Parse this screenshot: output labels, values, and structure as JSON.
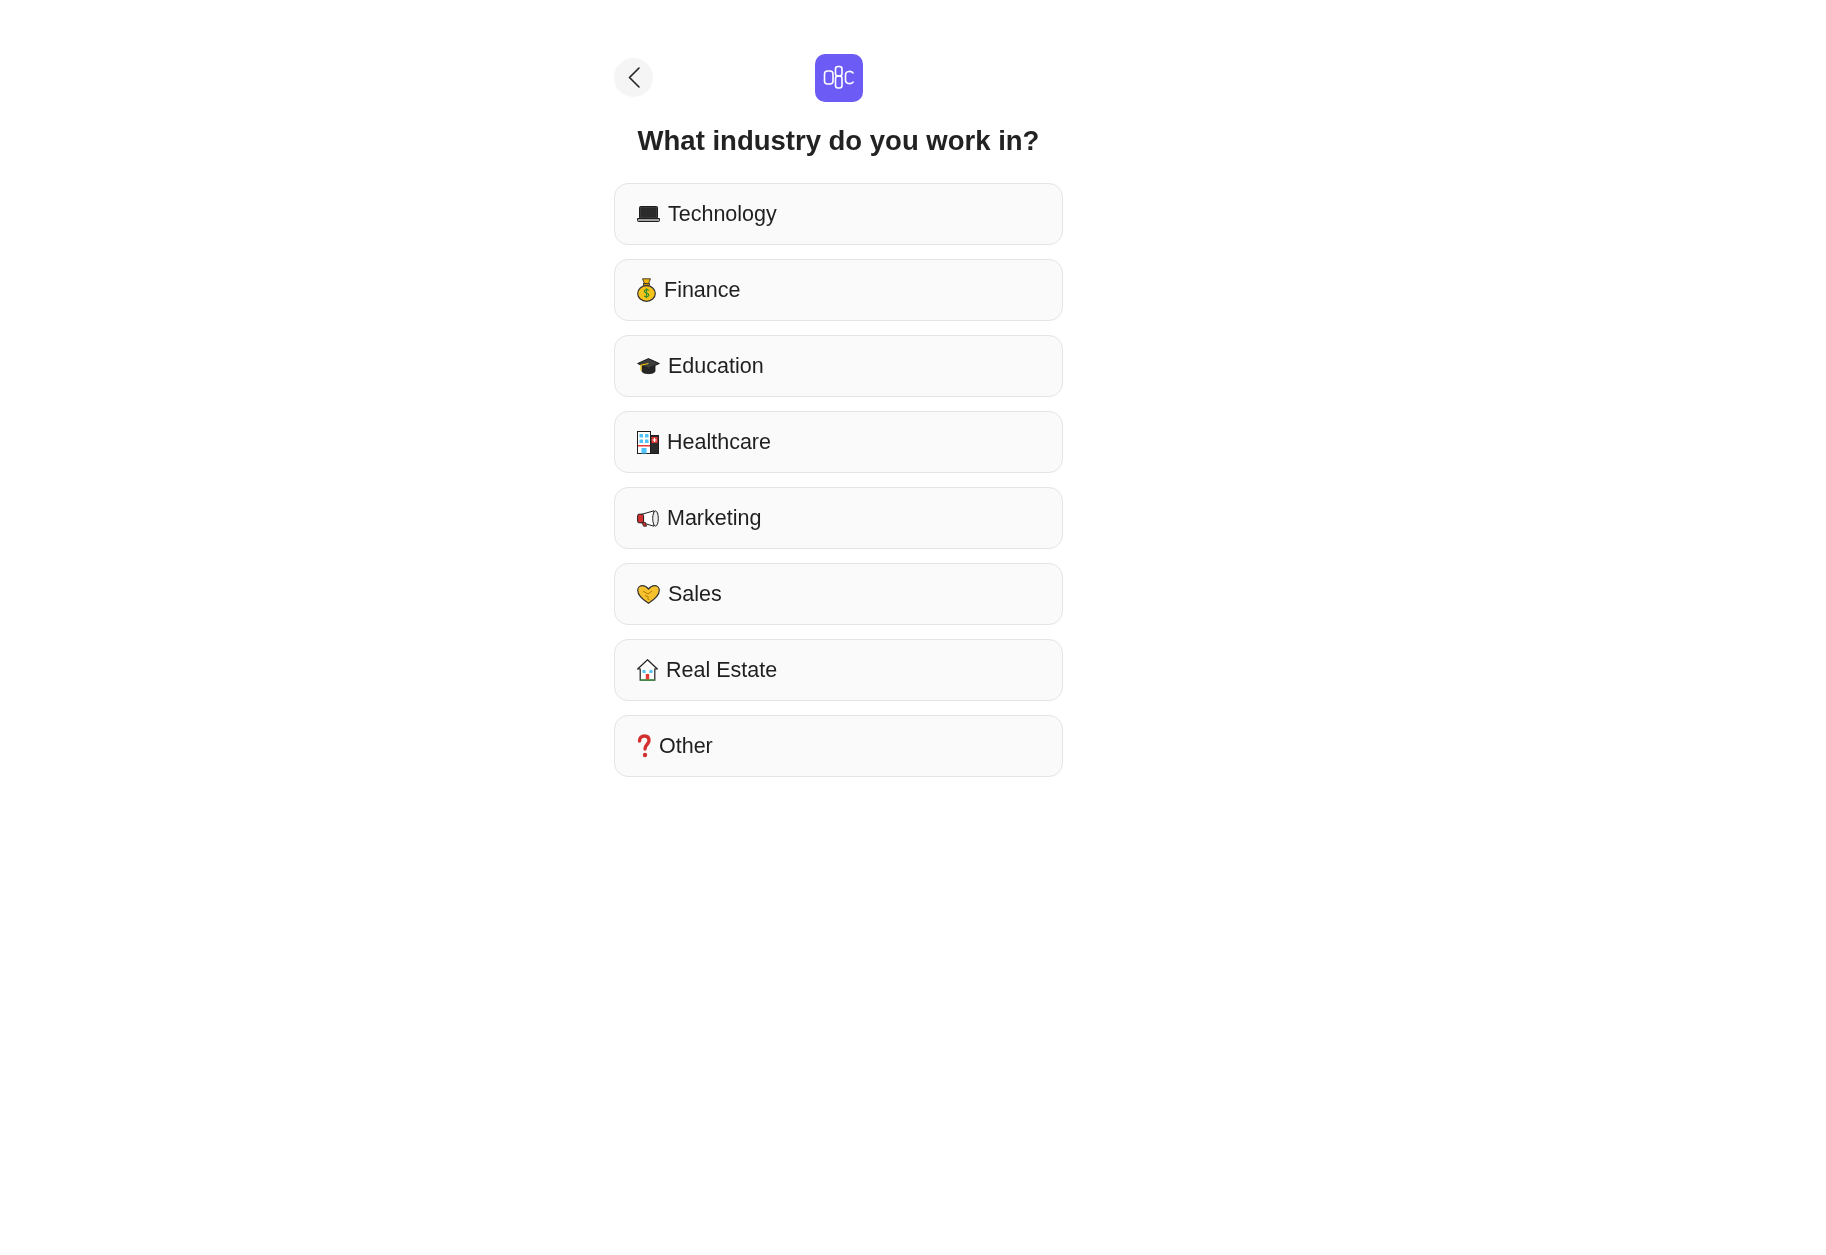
{
  "title": "What industry do you work in?",
  "options": [
    {
      "label": "Technology",
      "kind": "laptop",
      "selected": false
    },
    {
      "label": "Finance",
      "kind": "moneybag",
      "selected": false
    },
    {
      "label": "Education",
      "kind": "gradcap",
      "selected": false
    },
    {
      "label": "Healthcare",
      "kind": "hospital",
      "selected": false
    },
    {
      "label": "Marketing",
      "kind": "megaphone",
      "selected": false
    },
    {
      "label": "Sales",
      "kind": "handshake",
      "selected": false
    },
    {
      "label": "Real Estate",
      "kind": "house",
      "selected": false
    },
    {
      "label": "Other",
      "kind": "question",
      "selected": false
    }
  ]
}
